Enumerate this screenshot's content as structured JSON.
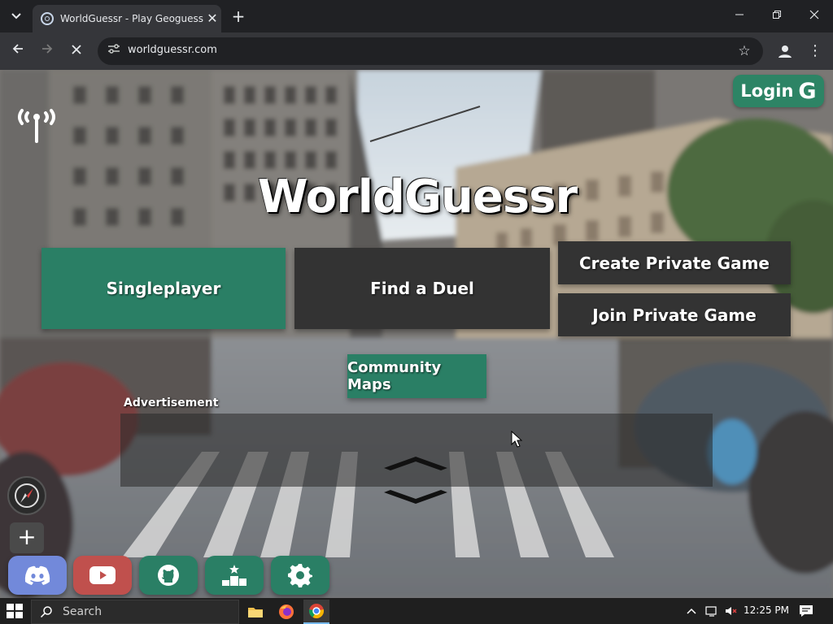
{
  "browser": {
    "tab_title": "WorldGuessr - Play Geoguessr Free",
    "new_tab_icon": "plus",
    "url": "worldguessr.com",
    "accent": "#202124"
  },
  "page": {
    "title": "WorldGuessr",
    "login_label": "Login",
    "login_icon_letter": "G",
    "menu": {
      "singleplayer": "Singleplayer",
      "find_duel": "Find a Duel",
      "create_private": "Create Private Game",
      "join_private": "Join Private Game",
      "community_maps": "Community Maps"
    },
    "ad_label": "Advertisement",
    "zoom_in": "+",
    "colors": {
      "green": "#2a7f65",
      "dark": "#333333",
      "discord": "#7289da",
      "youtube": "#c0504d"
    },
    "social": [
      "discord-icon",
      "youtube-icon",
      "github-icon",
      "leaderboard-icon",
      "settings-icon"
    ]
  },
  "taskbar": {
    "search_placeholder": "Search",
    "clock": "12:25 PM"
  }
}
